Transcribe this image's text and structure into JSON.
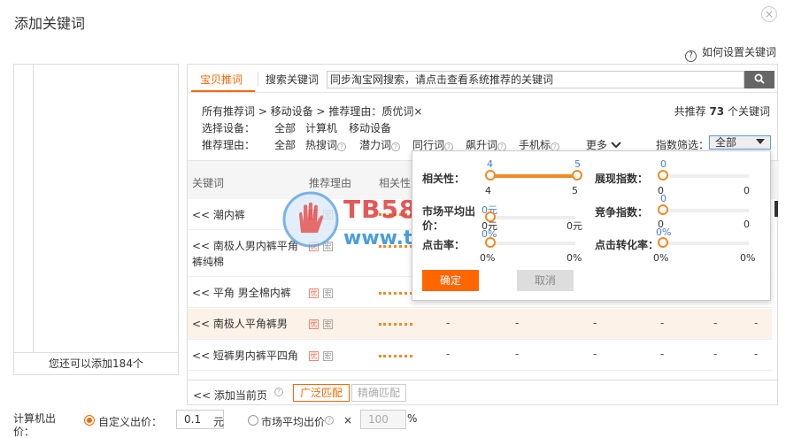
{
  "dialog": {
    "title": "添加关键词",
    "close_icon": "×"
  },
  "help": {
    "icon": "?",
    "label": "如何设置关键词"
  },
  "left_panel": {
    "remaining": "您还可以添加184个"
  },
  "tabs": [
    {
      "label": "宝贝推词",
      "active": true
    },
    {
      "label": "搜索关键词",
      "active": false
    }
  ],
  "search": {
    "placeholder": "同步淘宝网搜索，请点击查看系统推荐的关键词",
    "button_icon": "search-icon"
  },
  "breadcrumb": {
    "text": "所有推荐词 >   移动设备 > 推荐理由：质优词×"
  },
  "total": {
    "prefix": "共推荐",
    "count": "73",
    "suffix": "个关键词"
  },
  "device_filter": {
    "label": "选择设备：",
    "options": [
      "全部",
      "计算机",
      "移动设备"
    ]
  },
  "reason_filter": {
    "label": "推荐理由：",
    "options": [
      "全部",
      "热搜词",
      "潜力词",
      "同行词",
      "飙升词",
      "手机标"
    ],
    "more": "更多",
    "index_label": "指数筛选：",
    "index_value": "全部"
  },
  "table": {
    "headers": {
      "keyword": "关键词",
      "reason": "推荐理由",
      "relevance": "相关性"
    },
    "rows": [
      {
        "keyword": "<< 潮内裤",
        "badge1": "优",
        "badge2": "宏",
        "dashes": []
      },
      {
        "keyword": "<< 南极人男内裤平角裤纯棉",
        "badge1": "优",
        "badge2": "宏",
        "dashes": []
      },
      {
        "keyword": "<< 平角 男全棉内裤",
        "badge1": "优",
        "badge2": "宏",
        "dashes": []
      },
      {
        "keyword": "<< 南极人平角裤男",
        "badge1": "优",
        "badge2": "宏",
        "dashes": [
          "-",
          "-",
          "-",
          "-",
          "-",
          "-"
        ]
      },
      {
        "keyword": "<< 短裤男内裤平四角",
        "badge1": "优",
        "badge2": "宏",
        "dashes": [
          "-",
          "-",
          "-",
          "-",
          "-",
          "-"
        ]
      }
    ]
  },
  "bottom": {
    "add_page": "<<  添加当前页",
    "broad_match": "广泛匹配",
    "exact_match": "精确匹配"
  },
  "popup": {
    "relevance": {
      "label": "相关性：",
      "min": "4",
      "max": "5",
      "low": 4,
      "high": 5
    },
    "display_index": {
      "label": "展现指数：",
      "min": "0",
      "max": "0",
      "value_top": "0"
    },
    "market_avg": {
      "label": "市场平均出价：",
      "min": "0元",
      "max": "0元",
      "value_top": "0元"
    },
    "competition": {
      "label": "竞争指数：",
      "min": "0",
      "max": "0",
      "value_top": "0"
    },
    "ctr": {
      "label": "点击率：",
      "min": "0%",
      "max": "0%",
      "value_top": "0%"
    },
    "cvr": {
      "label": "点击转化率：",
      "min": "0%",
      "max": "0%",
      "value_top": "0%"
    },
    "ok": "确定",
    "cancel": "取消"
  },
  "watermark": {
    "line1": "TB58论坛",
    "line2": "www.tb58.net"
  },
  "pricing": {
    "label": "计算机出价：",
    "custom_label": "自定义出价：",
    "custom_value": "0.1",
    "unit": "元",
    "market_label": "市场平均出价",
    "times": "×",
    "percent_value": "100",
    "percent_unit": "%"
  },
  "colors": {
    "accent": "#ff6600",
    "slider": "#f08a24",
    "link_blue": "#4a7dc9"
  }
}
